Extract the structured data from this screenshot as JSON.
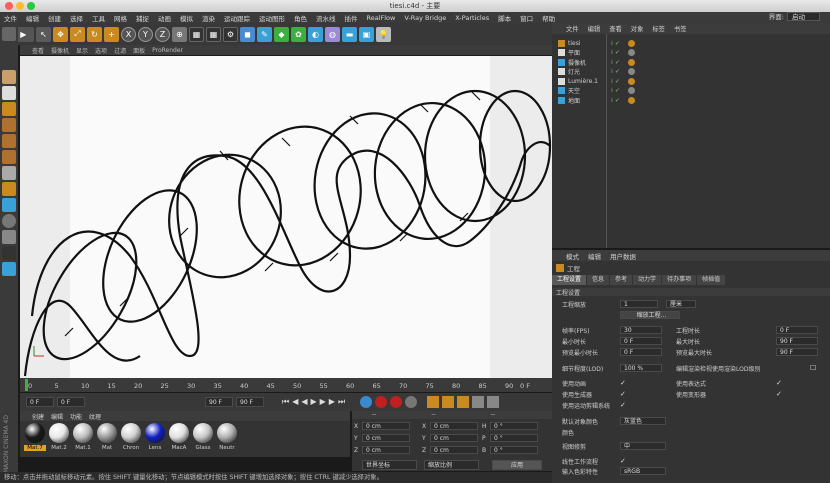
{
  "window": {
    "title": "tiesi.c4d - 主要"
  },
  "menu": [
    "文件",
    "编辑",
    "创建",
    "选择",
    "工具",
    "网格",
    "捕捉",
    "动画",
    "模拟",
    "渲染",
    "运动跟踪",
    "运动图形",
    "角色",
    "流水线",
    "插件",
    "RealFlow",
    "V-Ray Bridge",
    "X-Particles",
    "脚本",
    "窗口",
    "帮助"
  ],
  "layout": {
    "label": "界面:",
    "value": "启动"
  },
  "toolbar": {
    "axis_x": "X",
    "axis_y": "Y",
    "axis_z": "Z"
  },
  "viewport": {
    "menu": [
      "查看",
      "摄像机",
      "显示",
      "选项",
      "过滤",
      "面板",
      "ProRender"
    ]
  },
  "timeline": {
    "ticks": [
      "0",
      "5",
      "10",
      "15",
      "20",
      "25",
      "30",
      "35",
      "40",
      "45",
      "50",
      "55",
      "60",
      "65",
      "70",
      "75",
      "80",
      "85",
      "90"
    ],
    "end": "0 F"
  },
  "playback": {
    "start": "0 F",
    "current": "0 F",
    "end": "90 F",
    "max": "90 F"
  },
  "materials": {
    "menu": [
      "创建",
      "编辑",
      "功能",
      "纹理"
    ],
    "items": [
      {
        "name": "Mat.7",
        "color": "#1a1a1a"
      },
      {
        "name": "Mat.2",
        "color": "#e8e8e8"
      },
      {
        "name": "Mat.1",
        "color": "#bdbdbd"
      },
      {
        "name": "Mat",
        "color": "#9a9a9a"
      },
      {
        "name": "Chron",
        "color": "#d0d0d0"
      },
      {
        "name": "Lens",
        "color": "#1020c0"
      },
      {
        "name": "MacA",
        "color": "#e0e0e0"
      },
      {
        "name": "Glass",
        "color": "#c8c8c8"
      },
      {
        "name": "Neutr",
        "color": "#b0b0b0"
      }
    ]
  },
  "coords": {
    "header": [
      "--",
      "--",
      "--"
    ],
    "rows": [
      [
        "X",
        "0 cm",
        "X",
        "0 cm",
        "H",
        "0 °"
      ],
      [
        "Y",
        "0 cm",
        "Y",
        "0 cm",
        "P",
        "0 °"
      ],
      [
        "Z",
        "0 cm",
        "Z",
        "0 cm",
        "B",
        "0 °"
      ]
    ],
    "mode1": "世界坐标",
    "mode2": "缩放比例",
    "apply": "应用"
  },
  "status": "移动：点击并拖动鼠标移动元素。按住 SHIFT 键量化移动；节点编辑模式时按住 SHIFT 键增加选择对象；按住 CTRL 键减少选择对象。",
  "objects": {
    "menu": [
      "文件",
      "编辑",
      "查看",
      "对象",
      "标签",
      "书签"
    ],
    "items": [
      "tiesi",
      "平面",
      "摄像机",
      "灯光",
      "Lumière.1",
      "天空",
      "地面"
    ]
  },
  "attributes": {
    "menu": [
      "模式",
      "编辑",
      "用户数据"
    ],
    "object": "工程",
    "tabs": [
      "工程设置",
      "信息",
      "参考",
      "动力学",
      "待办事项",
      "帧插值"
    ],
    "section": "工程设置",
    "scale_label": "工程缩放",
    "scale_value": "1",
    "scale_unit": "厘米",
    "scale_button": "缩放工程...",
    "fps_label": "帧率(FPS)",
    "fps": "30",
    "duration_label": "工程时长",
    "duration": "0 F",
    "min_label": "最小时长",
    "min": "0 F",
    "max_label": "最大时长",
    "max": "90 F",
    "pmin_label": "预览最小时长",
    "pmin": "0 F",
    "pmax_label": "预览最大时长",
    "pmax": "90 F",
    "lod_label": "细节程度(LOD)",
    "lod": "100 %",
    "lod_check": "编辑渲染检视使用渲染LOD级别",
    "c1": "使用动画",
    "c2": "使用表达式",
    "c3": "使用生成器",
    "c4": "使用变形器",
    "c5": "使用运动剪辑系统",
    "defcolor_label": "默认对象颜色",
    "defcolor": "灰蓝色",
    "color_label": "颜色",
    "clip_label": "视图修剪",
    "clip": "中",
    "linear_label": "线性工作流程",
    "input_label": "输入色彩特性",
    "input": "sRGB"
  }
}
